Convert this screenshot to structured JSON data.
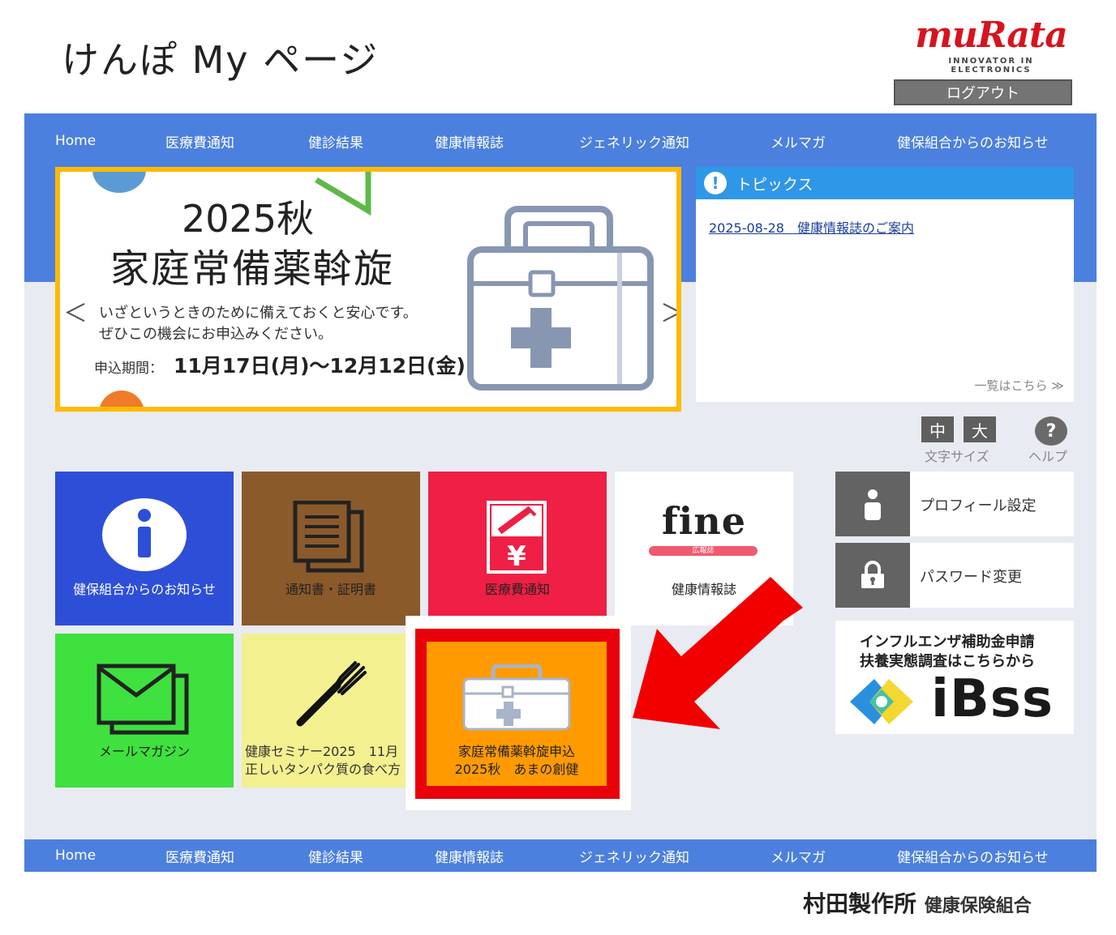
{
  "header": {
    "site_title": "けんぽ My ページ",
    "logo_text": "muRata",
    "logo_tagline": "INNOVATOR IN ELECTRONICS",
    "logout_label": "ログアウト"
  },
  "nav": {
    "items": [
      "Home",
      "医療費通知",
      "健診結果",
      "健康情報誌",
      "ジェネリック通知",
      "メルマガ",
      "健保組合からのお知らせ"
    ]
  },
  "banner": {
    "title_line1": "2025秋",
    "title_line2": "家庭常備薬斡旋",
    "text_line1": "いざというときのために備えておくと安心です。",
    "text_line2": "ぜひこの機会にお申込みください。",
    "period_label": "申込期間：",
    "period": "11月17日(月)〜12月12日(金)",
    "prev_symbol": "＜",
    "next_symbol": "＞"
  },
  "topics": {
    "title": "トピックス",
    "items": [
      {
        "date": "2025-08-28",
        "text": "健康情報誌のご案内"
      }
    ],
    "more_label": "一覧はこちら ≫"
  },
  "font_size": {
    "medium": "中",
    "large": "大",
    "label": "文字サイズ"
  },
  "help": {
    "symbol": "?",
    "label": "ヘルプ"
  },
  "tiles": {
    "info": "健保組合からのお知らせ",
    "docs": "通知書・証明書",
    "medical": "医療費通知",
    "fine_logo": "fine",
    "fine_badge": "広報誌",
    "fine_label": "健康情報誌",
    "mail": "メールマガジン",
    "seminar_line1": "健康セミナー2025　11月",
    "seminar_line2": "正しいタンパク質の食べ方",
    "kit_line1": "家庭常備薬斡旋申込",
    "kit_line2": "2025秋　あまの創健"
  },
  "side": {
    "profile": "プロフィール設定",
    "password": "パスワード変更",
    "ibss_line1": "インフルエンザ補助金申請",
    "ibss_line2": "扶養実態調査はこちらから",
    "ibss_word": "iBss"
  },
  "footer": {
    "org_main": "村田製作所",
    "org_sub": "健康保険組合"
  },
  "colors": {
    "nav_blue": "#4c80de",
    "banner_border": "#ffba00",
    "topics_header": "#2f97e7",
    "highlight_red": "#e8000a",
    "kit_orange": "#ff9a00"
  }
}
